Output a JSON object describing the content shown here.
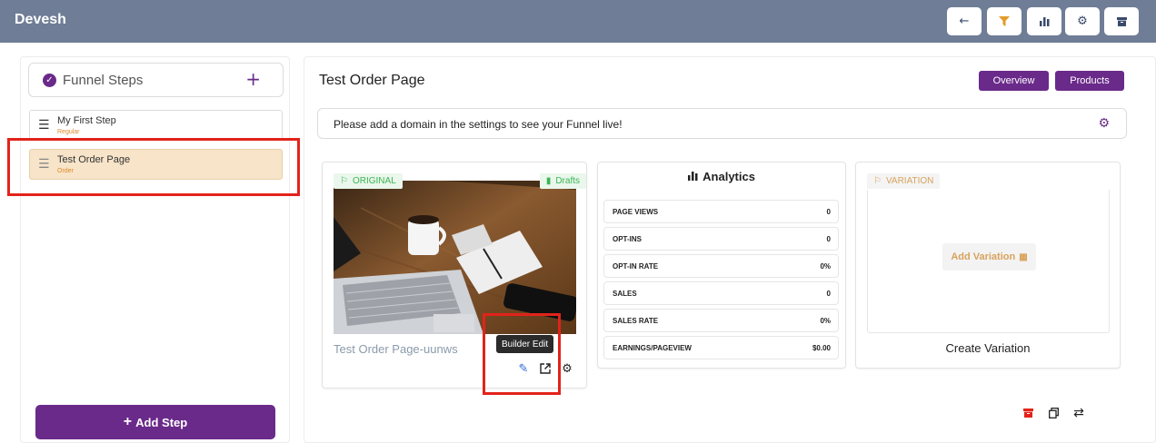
{
  "header": {
    "brand": "Devesh",
    "buttons": [
      {
        "name": "back-button",
        "icon": "arrow-left-icon",
        "glyph": "←"
      },
      {
        "name": "filter-button",
        "icon": "funnel-icon",
        "glyph": "▼"
      },
      {
        "name": "analytics-button",
        "icon": "bar-chart-icon",
        "glyph": "▮"
      },
      {
        "name": "settings-button",
        "icon": "gear-icon",
        "glyph": "⚙"
      },
      {
        "name": "archive-button",
        "icon": "archive-icon",
        "glyph": "▬"
      }
    ]
  },
  "sidebar": {
    "title": "Funnel Steps",
    "add_glyph": "+",
    "steps": [
      {
        "name": "My First Step",
        "type": "Regular"
      },
      {
        "name": "Test Order Page",
        "type": "Order"
      }
    ],
    "add_step_label": "Add Step",
    "add_step_glyph": "+"
  },
  "main": {
    "title": "Test Order Page",
    "overview_label": "Overview",
    "products_label": "Products",
    "notice": "Please add a domain in the settings to see your Funnel live!",
    "original": {
      "tag": "ORIGINAL",
      "draft_tag": "Drafts",
      "page_name": "Test Order Page-uunws",
      "tooltip": "Builder Edit"
    },
    "analytics": {
      "title": "Analytics",
      "rows": [
        {
          "label": "PAGE VIEWS",
          "value": "0"
        },
        {
          "label": "OPT-INS",
          "value": "0"
        },
        {
          "label": "OPT-IN RATE",
          "value": "0%"
        },
        {
          "label": "SALES",
          "value": "0"
        },
        {
          "label": "SALES RATE",
          "value": "0%"
        },
        {
          "label": "EARNINGS/PAGEVIEW",
          "value": "$0.00"
        }
      ]
    },
    "variation": {
      "tag": "VARIATION",
      "add_label": "Add Variation",
      "create_label": "Create Variation"
    }
  },
  "colors": {
    "header_bg": "#6f7d96",
    "accent_purple": "#6a2a8a",
    "active_step_bg": "#f7e4c9",
    "highlight_red": "#e2231a",
    "success_green": "#3cb554",
    "variation_orange": "#d8a25c"
  }
}
